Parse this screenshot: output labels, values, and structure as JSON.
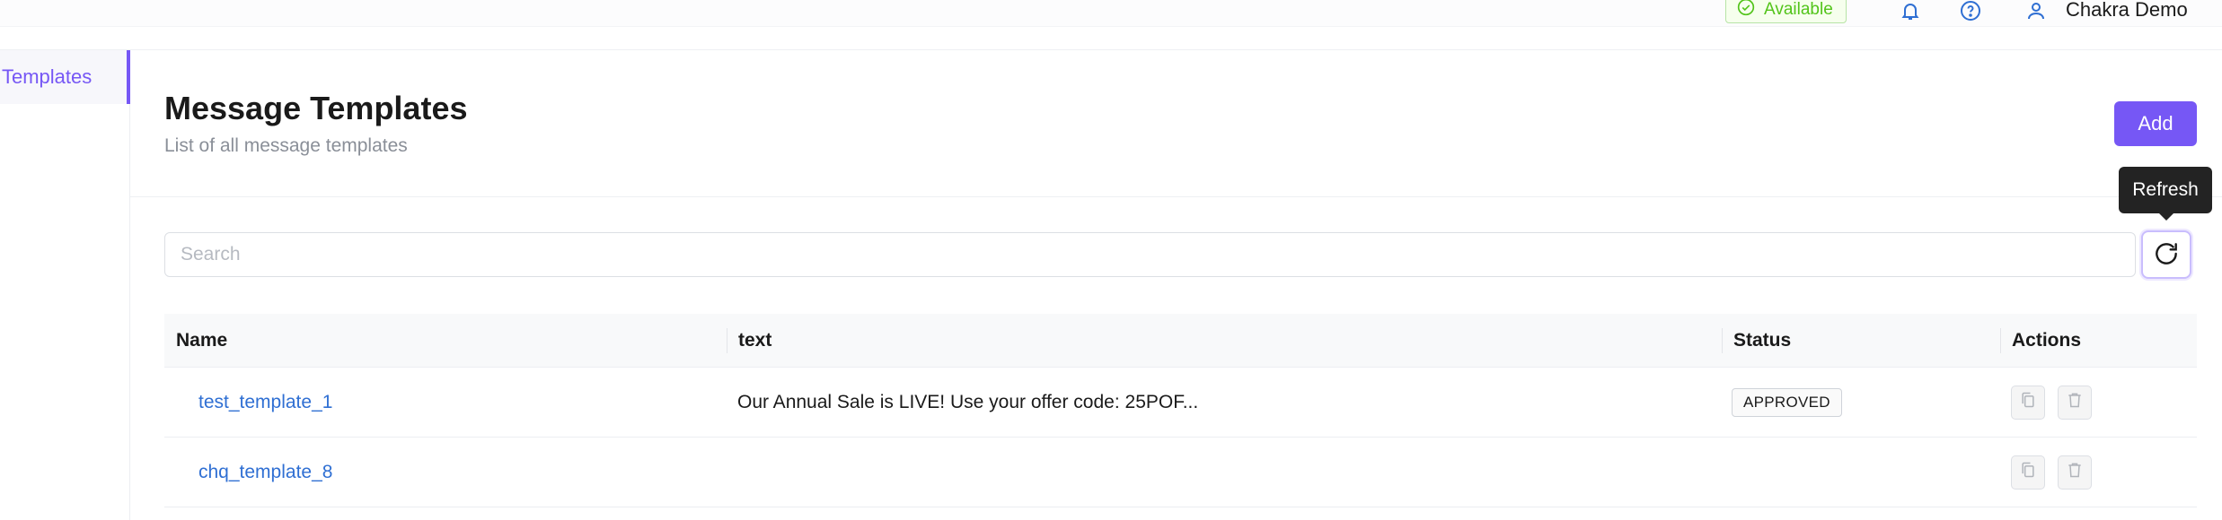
{
  "topbar": {
    "status_label": "Available",
    "user_name": "Chakra Demo"
  },
  "sidebar": {
    "items": [
      {
        "label": "Templates",
        "active": true
      }
    ]
  },
  "header": {
    "title": "Message Templates",
    "subtitle": "List of all message templates",
    "add_label": "Add"
  },
  "search": {
    "placeholder": "Search",
    "value": ""
  },
  "refresh": {
    "tooltip": "Refresh"
  },
  "table": {
    "columns": [
      "Name",
      "text",
      "Status",
      "Actions"
    ],
    "rows": [
      {
        "name": "test_template_1",
        "text": "Our Annual Sale is LIVE! Use your offer code: 25POF...",
        "status": "APPROVED"
      },
      {
        "name": "chq_template_8",
        "text": "",
        "status": ""
      }
    ]
  },
  "colors": {
    "accent": "#7657f5",
    "link": "#2f6fd3",
    "available": "#52c41a"
  },
  "icons": [
    "check-circle-icon",
    "bell-icon",
    "help-icon",
    "user-icon",
    "refresh-icon",
    "copy-icon",
    "trash-icon"
  ]
}
